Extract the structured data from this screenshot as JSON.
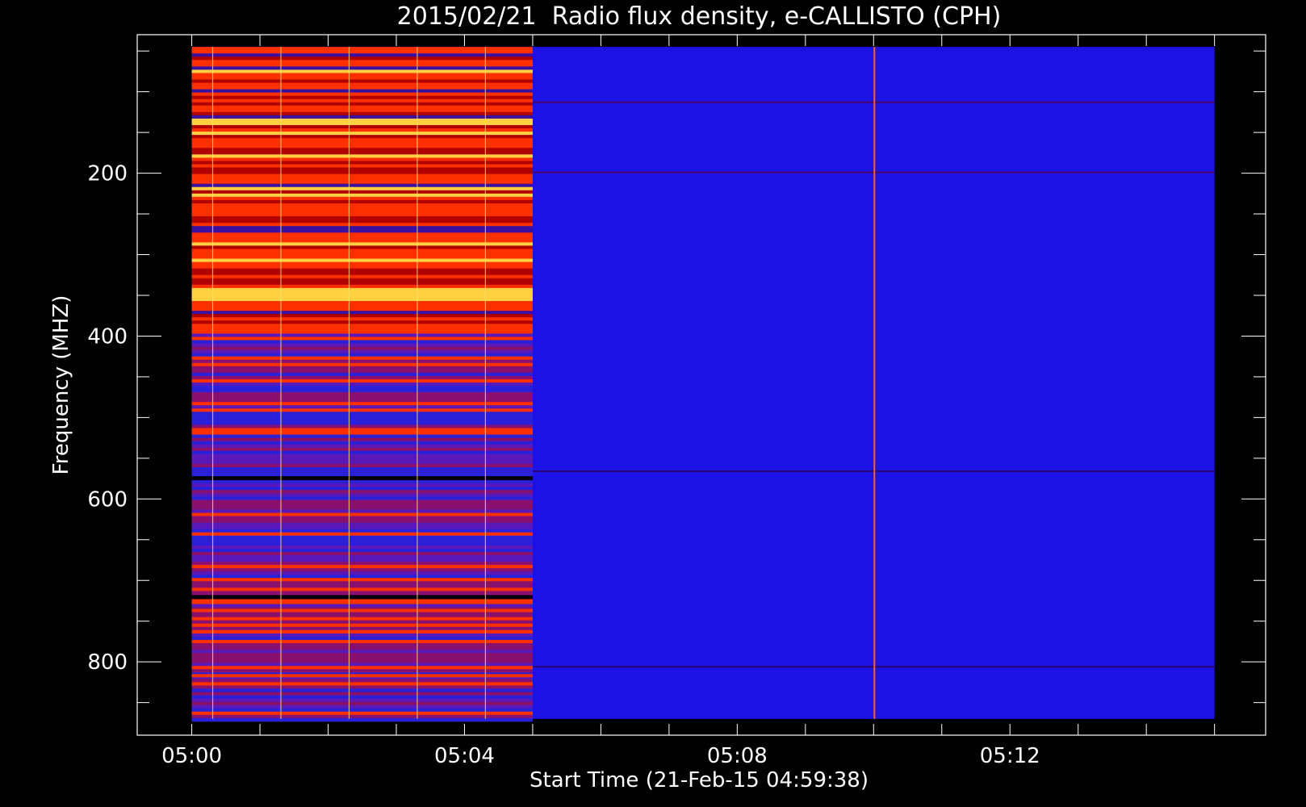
{
  "chart_data": {
    "type": "heatmap",
    "title": "2015/02/21  Radio flux density, e-CALLISTO (CPH)",
    "xlabel": "Start Time (21-Feb-15 04:59:38)",
    "ylabel": "Frequency (MHZ)",
    "x_range_minutes": [
      -0.8,
      15.75
    ],
    "x_data_range_minutes": [
      0,
      15.0
    ],
    "y_range_mhz": [
      30,
      890
    ],
    "y_data_range_mhz": [
      45,
      870
    ],
    "y_inverted": true,
    "x_major_ticks": [
      {
        "minute": 0,
        "label": "05:00"
      },
      {
        "minute": 4,
        "label": "05:04"
      },
      {
        "minute": 8,
        "label": "05:08"
      },
      {
        "minute": 12,
        "label": "05:12"
      }
    ],
    "x_minor_ticks": [
      1,
      2,
      3,
      5,
      6,
      7,
      9,
      10,
      11,
      13,
      14,
      15
    ],
    "y_major_ticks": [
      {
        "mhz": 200,
        "label": "200"
      },
      {
        "mhz": 400,
        "label": "400"
      },
      {
        "mhz": 600,
        "label": "600"
      },
      {
        "mhz": 800,
        "label": "800"
      }
    ],
    "y_minor_ticks": [
      50,
      100,
      150,
      250,
      300,
      350,
      450,
      500,
      550,
      650,
      700,
      750,
      850
    ],
    "high_flux_region": {
      "x_start_minute": 0,
      "x_end_minute": 5.0
    },
    "high_flux_strong_band_mhz": [
      45,
      395
    ],
    "background_level": "low (blue)",
    "vertical_spike_minutes": [
      0.3,
      1.3,
      2.3,
      3.3,
      4.3,
      10.0
    ],
    "strong_spike_minute": 10.0,
    "dark_band_mhz": [
      572,
      718
    ],
    "bright_band_mhz": [
      112,
      198,
      735,
      815
    ],
    "colors": {
      "low": "#1c12e6",
      "mid": "#b00000",
      "high": "#ff3000",
      "peak": "#ffd040",
      "axis": "#ffffff"
    }
  }
}
